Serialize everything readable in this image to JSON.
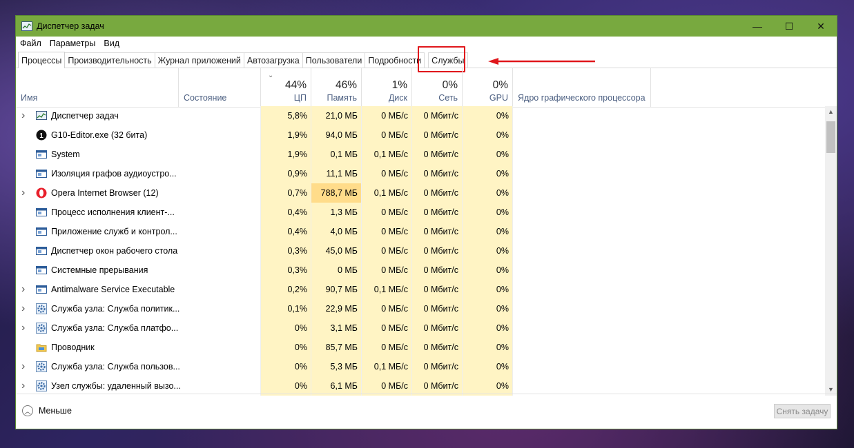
{
  "window": {
    "title": "Диспетчер задач"
  },
  "controls": {
    "minimize": "—",
    "maximize": "☐",
    "close": "✕"
  },
  "menu": [
    "Файл",
    "Параметры",
    "Вид"
  ],
  "tabs": [
    "Процессы",
    "Производительность",
    "Журнал приложений",
    "Автозагрузка",
    "Пользователи",
    "Подробности",
    "Службы"
  ],
  "active_tab": "Процессы",
  "highlight_color": "#e0161b",
  "accent_color": "#78a93f",
  "columns": {
    "name": "Имя",
    "status": "Состояние",
    "cpu": {
      "pct": "44%",
      "label": "ЦП"
    },
    "mem": {
      "pct": "46%",
      "label": "Память"
    },
    "disk": {
      "pct": "1%",
      "label": "Диск"
    },
    "net": {
      "pct": "0%",
      "label": "Сеть"
    },
    "gpu": {
      "pct": "0%",
      "label": "GPU"
    },
    "gpu_engine": "Ядро графического процессора"
  },
  "processes": [
    {
      "expand": true,
      "icon": "task-manager-icon",
      "name": "Диспетчер задач",
      "cpu": "5,8%",
      "mem": "21,0 МБ",
      "disk": "0 МБ/с",
      "net": "0 Мбит/с",
      "gpu": "0%"
    },
    {
      "expand": false,
      "icon": "g10-editor-icon",
      "name": "G10-Editor.exe (32 бита)",
      "cpu": "1,9%",
      "mem": "94,0 МБ",
      "disk": "0 МБ/с",
      "net": "0 Мбит/с",
      "gpu": "0%"
    },
    {
      "expand": false,
      "icon": "system-window-icon",
      "name": "System",
      "cpu": "1,9%",
      "mem": "0,1 МБ",
      "disk": "0,1 МБ/с",
      "net": "0 Мбит/с",
      "gpu": "0%"
    },
    {
      "expand": false,
      "icon": "system-window-icon",
      "name": "Изоляция графов аудиоустро...",
      "cpu": "0,9%",
      "mem": "11,1 МБ",
      "disk": "0 МБ/с",
      "net": "0 Мбит/с",
      "gpu": "0%"
    },
    {
      "expand": true,
      "icon": "opera-icon",
      "name": "Opera Internet Browser (12)",
      "cpu": "0,7%",
      "mem": "788,7 МБ",
      "disk": "0,1 МБ/с",
      "net": "0 Мбит/с",
      "gpu": "0%"
    },
    {
      "expand": false,
      "icon": "system-window-icon",
      "name": "Процесс исполнения клиент-...",
      "cpu": "0,4%",
      "mem": "1,3 МБ",
      "disk": "0 МБ/с",
      "net": "0 Мбит/с",
      "gpu": "0%"
    },
    {
      "expand": false,
      "icon": "system-window-icon",
      "name": "Приложение служб и контрол...",
      "cpu": "0,4%",
      "mem": "4,0 МБ",
      "disk": "0 МБ/с",
      "net": "0 Мбит/с",
      "gpu": "0%"
    },
    {
      "expand": false,
      "icon": "system-window-icon",
      "name": "Диспетчер окон рабочего стола",
      "cpu": "0,3%",
      "mem": "45,0 МБ",
      "disk": "0 МБ/с",
      "net": "0 Мбит/с",
      "gpu": "0%"
    },
    {
      "expand": false,
      "icon": "system-window-icon",
      "name": "Системные прерывания",
      "cpu": "0,3%",
      "mem": "0 МБ",
      "disk": "0 МБ/с",
      "net": "0 Мбит/с",
      "gpu": "0%"
    },
    {
      "expand": true,
      "icon": "system-window-icon",
      "name": "Antimalware Service Executable",
      "cpu": "0,2%",
      "mem": "90,7 МБ",
      "disk": "0,1 МБ/с",
      "net": "0 Мбит/с",
      "gpu": "0%"
    },
    {
      "expand": true,
      "icon": "service-gear-icon",
      "name": "Служба узла: Служба политик...",
      "cpu": "0,1%",
      "mem": "22,9 МБ",
      "disk": "0 МБ/с",
      "net": "0 Мбит/с",
      "gpu": "0%"
    },
    {
      "expand": true,
      "icon": "service-gear-icon",
      "name": "Служба узла: Служба платфо...",
      "cpu": "0%",
      "mem": "3,1 МБ",
      "disk": "0 МБ/с",
      "net": "0 Мбит/с",
      "gpu": "0%"
    },
    {
      "expand": false,
      "icon": "explorer-folder-icon",
      "name": "Проводник",
      "cpu": "0%",
      "mem": "85,7 МБ",
      "disk": "0 МБ/с",
      "net": "0 Мбит/с",
      "gpu": "0%"
    },
    {
      "expand": true,
      "icon": "service-gear-icon",
      "name": "Служба узла: Служба пользов...",
      "cpu": "0%",
      "mem": "5,3 МБ",
      "disk": "0,1 МБ/с",
      "net": "0 Мбит/с",
      "gpu": "0%"
    },
    {
      "expand": true,
      "icon": "service-gear-icon",
      "name": "Узел службы: удаленный вызо...",
      "cpu": "0%",
      "mem": "6,1 МБ",
      "disk": "0 МБ/с",
      "net": "0 Мбит/с",
      "gpu": "0%"
    }
  ],
  "footer": {
    "less": "Меньше",
    "end_task": "Снять задачу"
  }
}
